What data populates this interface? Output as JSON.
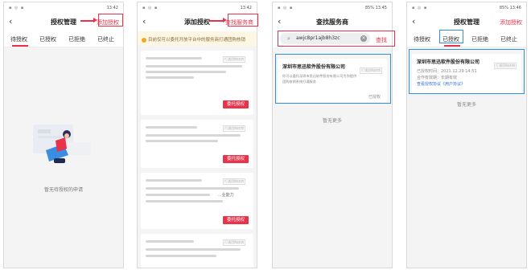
{
  "screen1": {
    "time": "13:42",
    "title": "授权管理",
    "action": "添加授权",
    "tabs": [
      "待授权",
      "已授权",
      "已拒绝",
      "已终止"
    ],
    "empty_text": "暂无待授权的申请"
  },
  "screen2": {
    "time": "13:42",
    "title": "添加授权",
    "action": "查找服务商",
    "notice": "目前仅可以委托开放平台中的服务商打通团购核销",
    "tag": "打通团购核销",
    "button_label": "委托授权",
    "partial_text": "...业能力"
  },
  "screen3": {
    "battery": "85%",
    "time": "13:45",
    "title": "查找服务商",
    "search_value": "awjc8pr1ajb8h3zc",
    "search_button": "查找",
    "result": {
      "name": "深圳市思迅软件股份有限公司",
      "tag": "打通团购核销",
      "desc_line1": "你可以委托深圳市思迅软件股份有限公司为你提供",
      "desc_line2": "团购核销系统打通服务",
      "status": "已授权"
    },
    "more": "暂无更多"
  },
  "screen4": {
    "battery": "85%",
    "time": "13:46",
    "title": "授权管理",
    "action": "添加授权",
    "tabs": [
      "待授权",
      "已授权",
      "已拒绝",
      "已终止"
    ],
    "card": {
      "name": "深圳市思迅软件股份有限公司",
      "tag": "打通团购核销",
      "auth_time": "已授权时间：2021.12.29 14:51",
      "valid": "合作有效期：长期有效",
      "agreement": "查看授权协议《用户协议》"
    },
    "more": "暂无更多"
  },
  "colors": {
    "accent": "#e8334a",
    "highlight": "#2f8fe0",
    "notice_bg": "#fdf6e3"
  }
}
